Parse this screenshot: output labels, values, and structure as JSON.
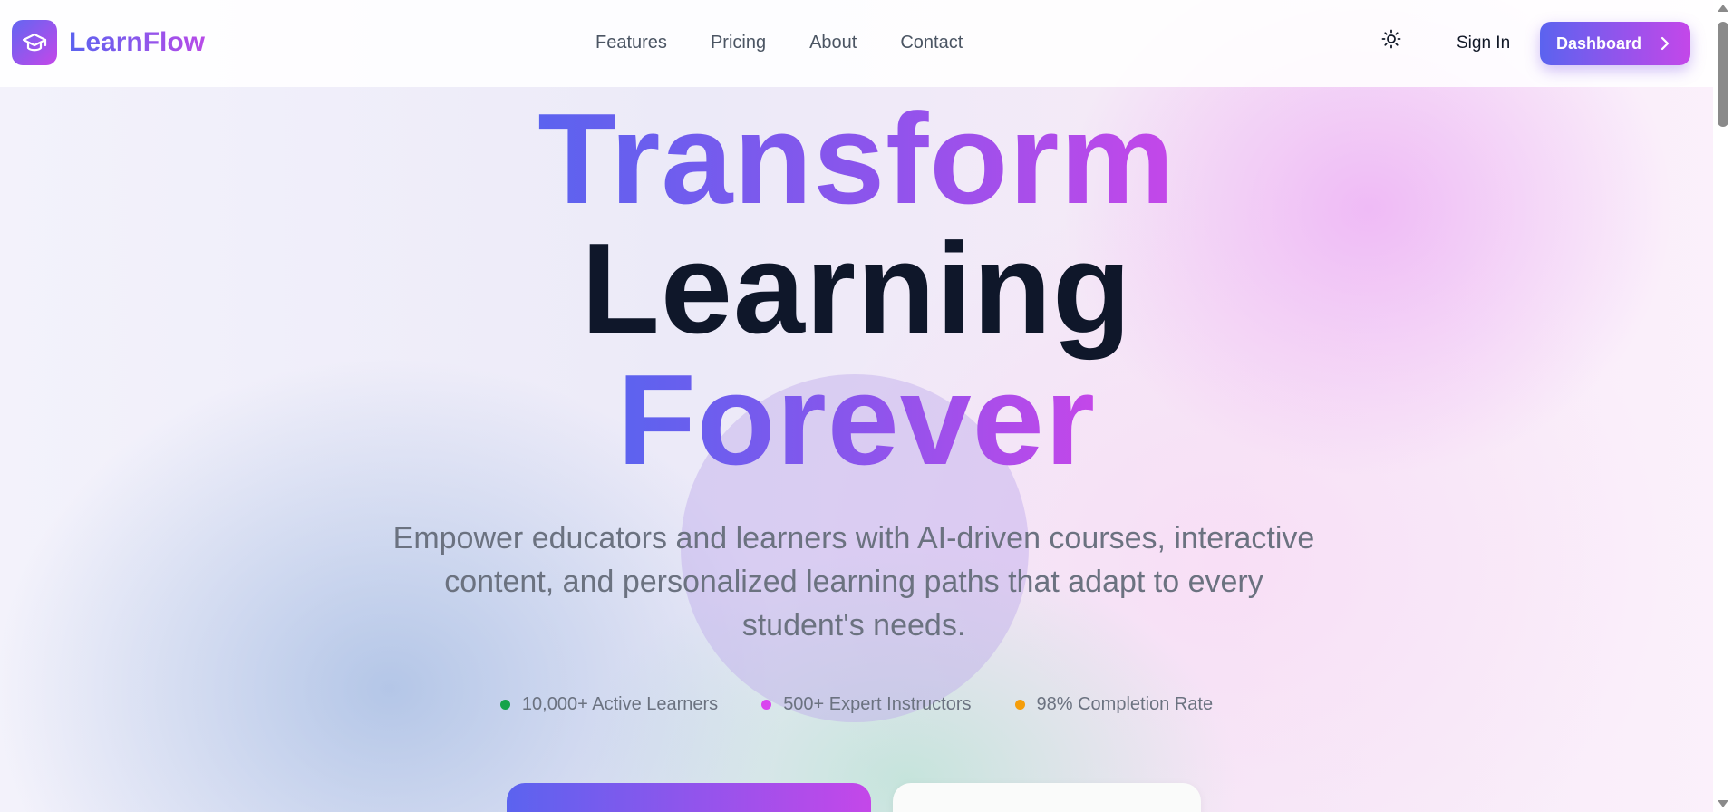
{
  "brand": {
    "name": "LearnFlow",
    "icon": "graduation-cap-icon",
    "gradient": [
      "#6366f1",
      "#c447e9"
    ]
  },
  "nav": {
    "items": [
      {
        "label": "Features"
      },
      {
        "label": "Pricing"
      },
      {
        "label": "About"
      },
      {
        "label": "Contact"
      }
    ]
  },
  "header_actions": {
    "theme_icon": "sun-icon",
    "sign_in_label": "Sign In",
    "dashboard_label": "Dashboard",
    "dashboard_icon": "chevron-right-icon"
  },
  "hero": {
    "line1": "Transform",
    "line2": "Learning",
    "line3": "Forever",
    "subtitle": "Empower educators and learners with AI-driven courses, interactive content, and personalized learning paths that adapt to every student's needs."
  },
  "stats": [
    {
      "label": "10,000+ Active Learners",
      "color": "#16a34a"
    },
    {
      "label": "500+ Expert Instructors",
      "color": "#d946ef"
    },
    {
      "label": "98% Completion Rate",
      "color": "#f59e0b"
    }
  ],
  "colors": {
    "accent_start": "#5b63ef",
    "accent_end": "#c447e9",
    "heading_dark": "#0f172a",
    "body_text": "#6b7280"
  }
}
